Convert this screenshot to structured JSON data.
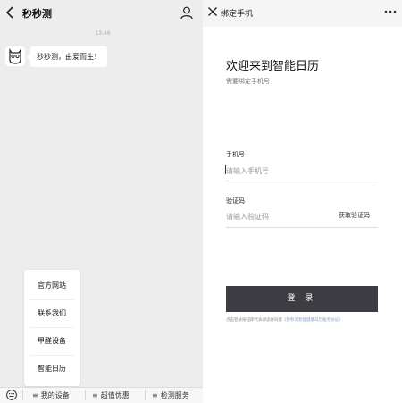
{
  "chat": {
    "title": "秒秒测",
    "timestamp": "13:46",
    "message": "秒秒测，由爱而生！",
    "menu_items": [
      "官方网站",
      "联系我们",
      "甲醛设备",
      "智能日历"
    ],
    "bottom_bar": [
      {
        "label": "我的设备",
        "icon": "menu-icon"
      },
      {
        "label": "超值优惠",
        "icon": "menu-icon"
      },
      {
        "label": "检测服务",
        "icon": "menu-icon"
      }
    ]
  },
  "bind": {
    "title": "绑定手机",
    "heading": "欢迎来到智能日历",
    "subheading": "需要绑定手机号",
    "phone_label": "手机号",
    "phone_placeholder": "请输入手机号",
    "code_label": "验证码",
    "code_placeholder": "请输入验证码",
    "get_code": "获取验证码",
    "login_button": "登 录",
    "agreement_prefix": "点击登录按钮即代表阅读并同意",
    "agreement_link": "《秒秒测智能健康日历服务协议》"
  },
  "colors": {
    "login_button_bg": "#3d3d43",
    "chat_bg": "#ededed",
    "agreement_link": "#8aa0c4"
  }
}
